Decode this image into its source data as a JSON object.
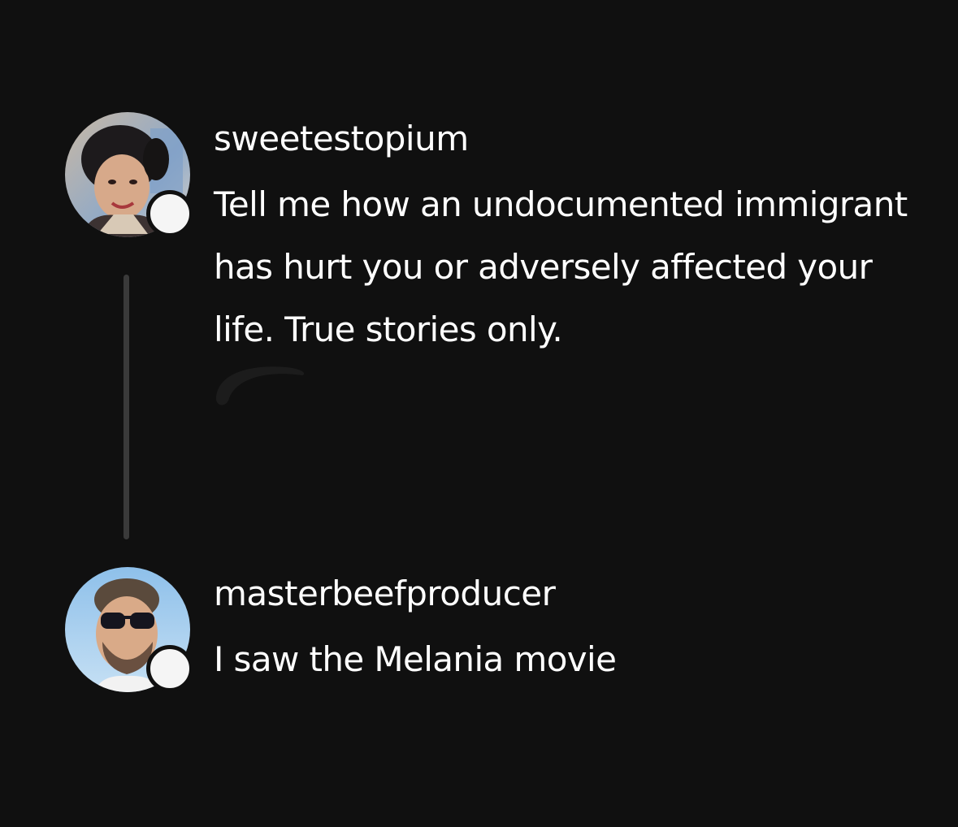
{
  "thread": {
    "posts": [
      {
        "username": "sweetestopium",
        "text": "Tell me how an undocumented immigrant has hurt you or adversely affected your life. True stories only."
      },
      {
        "username": "masterbeefproducer",
        "text": "I saw the Melania movie"
      }
    ]
  },
  "colors": {
    "background": "#101010",
    "text": "#ffffff",
    "thread_line": "#3a3a3a",
    "follow_dot": "#f5f5f5"
  },
  "icons": {
    "follow_badge": "follow-badge-icon",
    "faded_action": "faded-action-icon"
  }
}
